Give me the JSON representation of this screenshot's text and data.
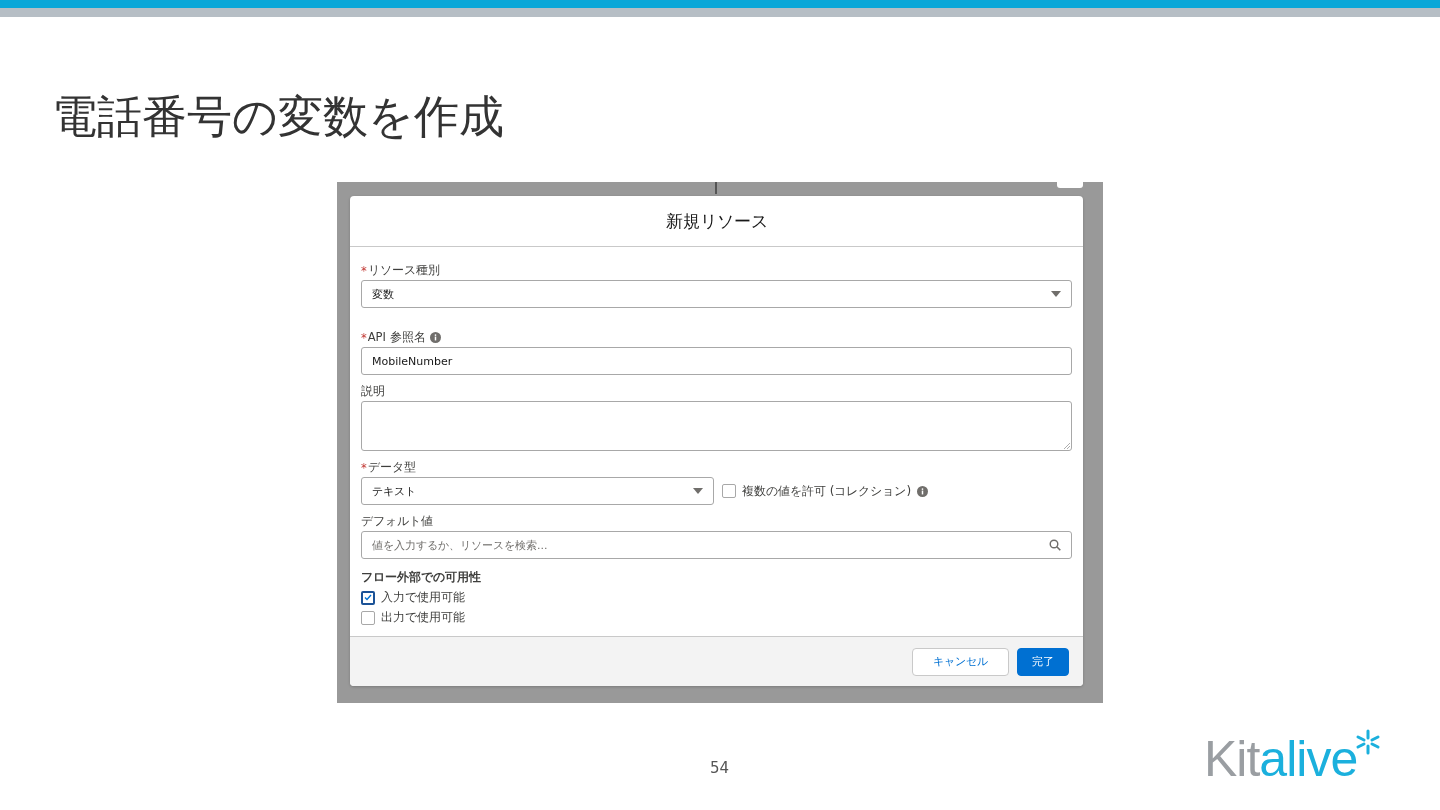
{
  "slide": {
    "title": "電話番号の変数を作成",
    "page_number": "54",
    "logo": {
      "lead": "Kit",
      "tail": "alive"
    }
  },
  "dialog": {
    "title": "新規リソース",
    "fields": [
      {
        "kind": "select",
        "required_mark": "*",
        "label": "リソース種別",
        "value": "変数"
      },
      {
        "kind": "text",
        "required_mark": "*",
        "label": "API 参照名",
        "info": true,
        "value": "MobileNumber"
      },
      {
        "kind": "textarea",
        "label": "説明"
      },
      {
        "kind": "select",
        "required_mark": "*",
        "label": "データ型",
        "value": "テキスト",
        "option": {
          "label": "複数の値を許可 (コレクション)",
          "checked": false,
          "info": true
        }
      },
      {
        "kind": "search",
        "label": "デフォルト値",
        "placeholder": "値を入力するか、リソースを検索..."
      }
    ],
    "availability": {
      "heading": "フロー外部での可用性",
      "options": [
        {
          "label": "入力で使用可能",
          "checked": true
        },
        {
          "label": "出力で使用可能",
          "checked": false
        }
      ]
    },
    "buttons": [
      {
        "label": "キャンセル",
        "kind": "neutral"
      },
      {
        "label": "完了",
        "kind": "brand"
      }
    ]
  }
}
